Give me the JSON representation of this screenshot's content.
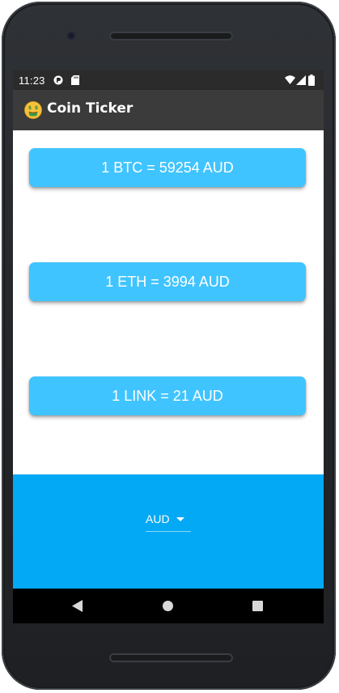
{
  "status_bar": {
    "time": "11:23",
    "icons": [
      "notification-icon",
      "sd-card-icon",
      "wifi-icon",
      "signal-icon",
      "battery-icon"
    ]
  },
  "app_bar": {
    "emoji_icon": "money-mouth-face-icon",
    "title": "Coin Ticker"
  },
  "rates": [
    {
      "label": "1 BTC = 59254 AUD"
    },
    {
      "label": "1 ETH = 3994 AUD"
    },
    {
      "label": "1 LINK = 21 AUD"
    }
  ],
  "currency_picker": {
    "selected": "AUD"
  },
  "nav_bar": {
    "buttons": [
      "back-icon",
      "home-icon",
      "recents-icon"
    ]
  },
  "colors": {
    "app_bar": "#3b3b3b",
    "card": "#40c4ff",
    "bottom_panel": "#03a9f4",
    "nav_bar": "#000000"
  }
}
